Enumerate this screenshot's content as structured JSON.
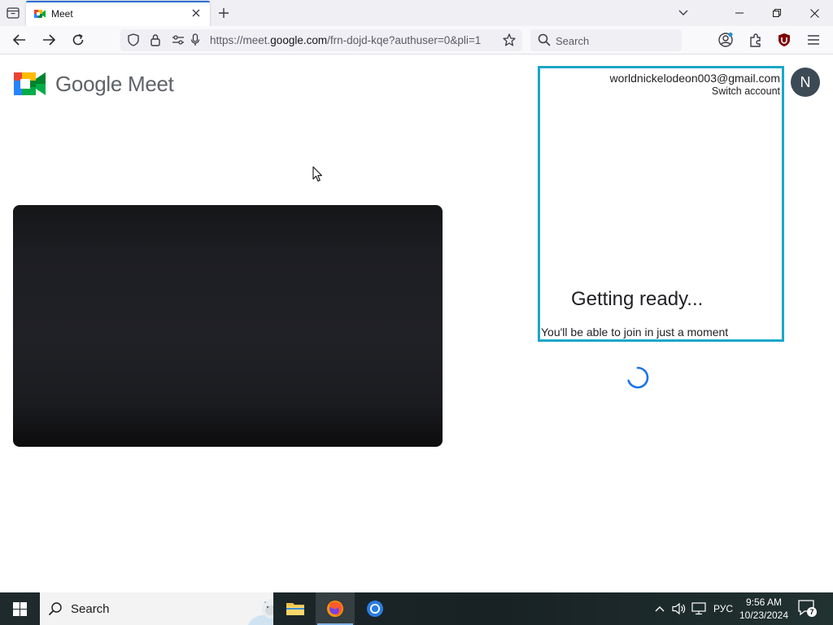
{
  "browser": {
    "tab": {
      "title": "Meet"
    },
    "url": {
      "prefix": "https://meet.",
      "host": "google.com",
      "path": "/frn-dojd-kqe?authuser=0&pli=1"
    },
    "search": {
      "placeholder": "Search"
    }
  },
  "page": {
    "brand": "Google Meet",
    "account": {
      "email": "worldnickelodeon003@gmail.com",
      "switch_label": "Switch account",
      "avatar_letter": "N"
    },
    "status": {
      "title": "Getting ready...",
      "subtitle": "You'll be able to join in just a moment"
    }
  },
  "taskbar": {
    "search_placeholder": "Search",
    "language": "РУС",
    "time": "9:56 AM",
    "date": "10/23/2024",
    "notification_count": "7"
  },
  "colors": {
    "tab_accent": "#2b6fd6",
    "highlight_border": "#1aa7c9",
    "avatar_bg": "#3c4a55",
    "spinner": "#1a73e8"
  }
}
